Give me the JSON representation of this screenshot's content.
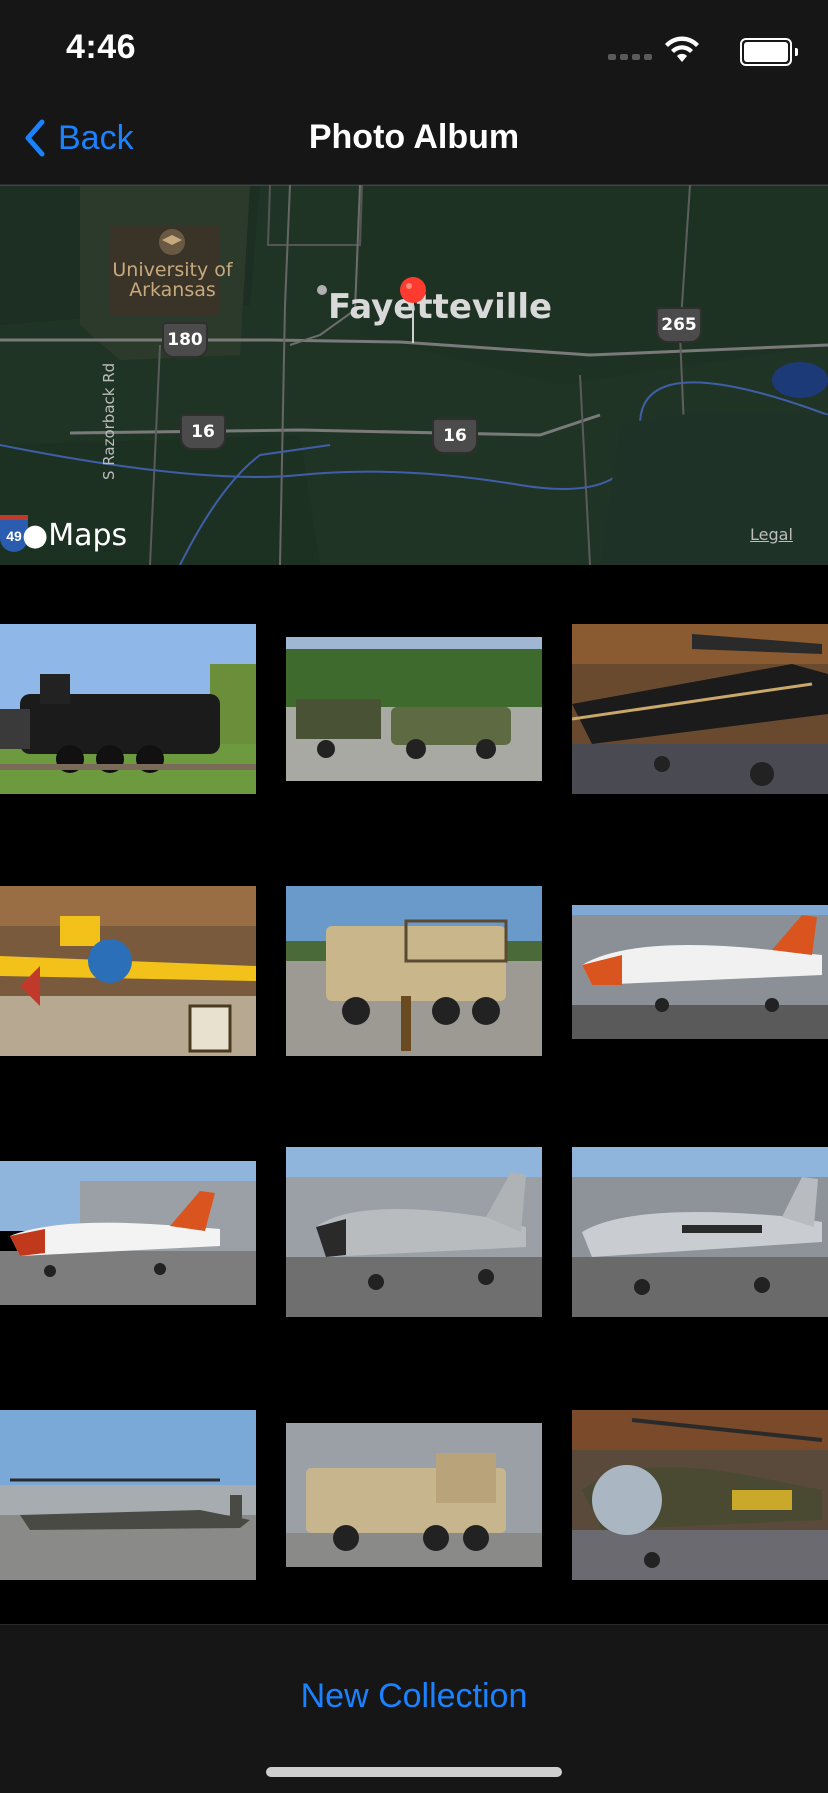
{
  "status_bar": {
    "time": "4:46",
    "battery_level": 1.0
  },
  "nav": {
    "back_label": "Back",
    "title": "Photo Album",
    "accent_color": "#1a82ff"
  },
  "map": {
    "city": "Fayetteville",
    "university": "University of Arkansas",
    "road_label": "S Razorback Rd",
    "route_shields": [
      "180",
      "265",
      "16",
      "16"
    ],
    "interstate": "49",
    "brand": "Maps",
    "legal": "Legal"
  },
  "photos": [
    {
      "subject": "steam locomotive"
    },
    {
      "subject": "military pickup truck with trailer"
    },
    {
      "subject": "vintage monoplane in hangar"
    },
    {
      "subject": "yellow biplane in hangar"
    },
    {
      "subject": "military cargo truck"
    },
    {
      "subject": "white jet trainer with orange nose"
    },
    {
      "subject": "jet trainer on tarmac"
    },
    {
      "subject": "gray fighter jet"
    },
    {
      "subject": "silver U.S. Air Force jet"
    },
    {
      "subject": "attack helicopter"
    },
    {
      "subject": "military wrecker truck"
    },
    {
      "subject": "Army helicopter in hangar"
    }
  ],
  "toolbar": {
    "new_collection_label": "New Collection"
  }
}
